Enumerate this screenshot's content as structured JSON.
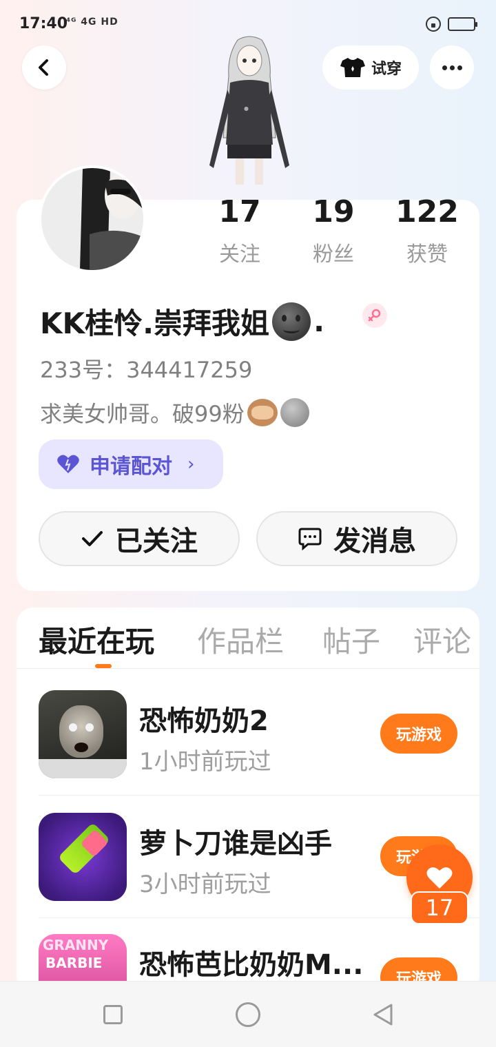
{
  "status_bar": {
    "time": "17:40",
    "network": "⁴ᴳ 4G HD"
  },
  "header": {
    "tryon_label": "试穿"
  },
  "profile": {
    "stats": [
      {
        "value": "17",
        "label": "关注"
      },
      {
        "value": "19",
        "label": "粉丝"
      },
      {
        "value": "122",
        "label": "获赞"
      }
    ],
    "nickname_prefix": "KK桂怜.崇拜我姐",
    "nickname_suffix": ".",
    "id_line": "233号：344417259",
    "bio": "求美女帅哥。破99粉",
    "pair_label": "申请配对",
    "follow_label": "已关注",
    "message_label": "发消息"
  },
  "tabs": [
    {
      "label": "最近在玩",
      "active": true
    },
    {
      "label": "作品栏",
      "active": false
    },
    {
      "label": "帖子",
      "active": false
    },
    {
      "label": "评论",
      "active": false
    }
  ],
  "games": [
    {
      "title": "恐怖奶奶2",
      "time": "1小时前玩过",
      "button": "玩游戏"
    },
    {
      "title": "萝卜刀谁是凶手",
      "time": "3小时前玩过",
      "button": "玩游戏"
    },
    {
      "title": "恐怖芭比奶奶M...",
      "time": "",
      "button": "玩游戏",
      "icon_text_1": "GRANNY",
      "icon_text_2": "BARBIE"
    }
  ],
  "like_count": "17",
  "colors": {
    "accent": "#ff7a1a",
    "pair_bg": "#e8e6ff",
    "pair_text": "#5b55d4"
  }
}
